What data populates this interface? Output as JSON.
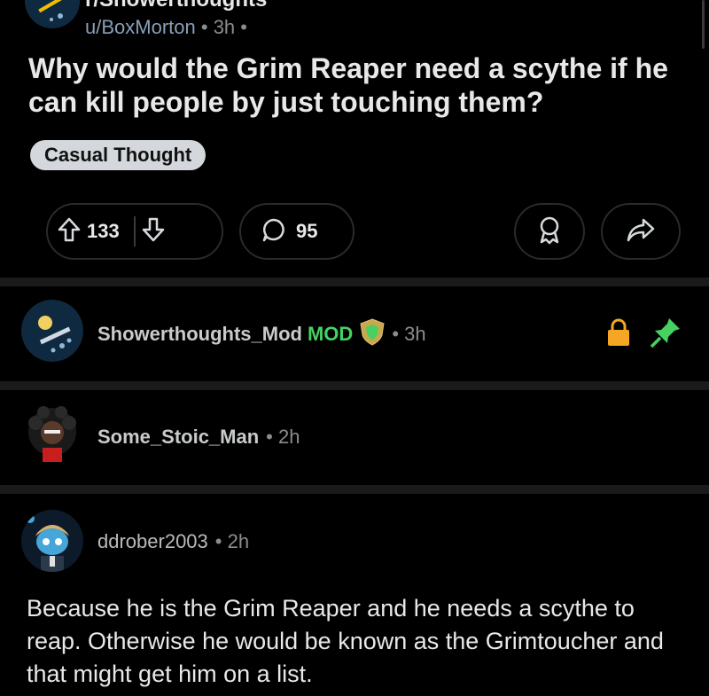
{
  "subreddit": {
    "name": "r/Showerthoughts"
  },
  "post": {
    "author": "u/BoxMorton",
    "age": "3h",
    "title": "Why would the Grim Reaper need a scythe if he can kill people by just touching them?",
    "flair": "Casual Thought",
    "upvotes": "133",
    "comments": "95"
  },
  "comments": [
    {
      "author": "Showerthoughts_Mod",
      "badge": "MOD",
      "age": "3h",
      "locked": true,
      "pinned": true
    },
    {
      "author": "Some_Stoic_Man",
      "age": "2h"
    },
    {
      "author": "ddrober2003",
      "age": "2h",
      "body": "Because he is the Grim Reaper and he needs a scythe to reap. Otherwise he would be known as the Grimtoucher and that might get him on a list."
    }
  ],
  "colors": {
    "background": "#000000",
    "mod_green": "#46d160",
    "lock_orange": "#f5a623",
    "pin_green": "#46d160"
  }
}
